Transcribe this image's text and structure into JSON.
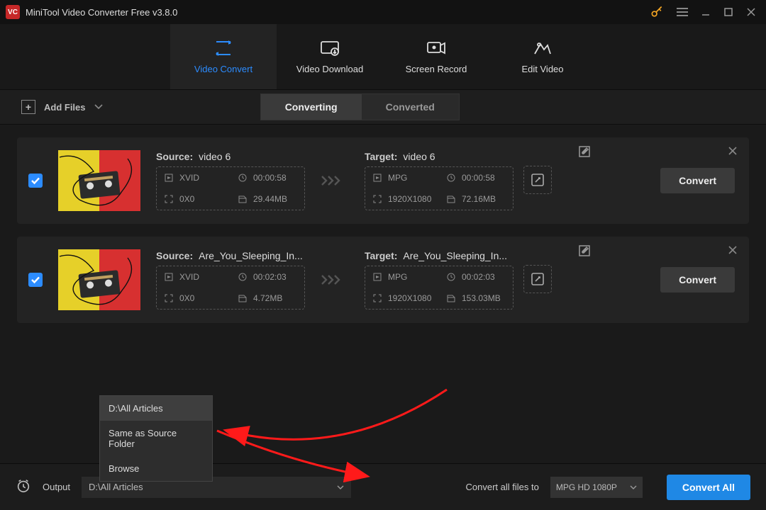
{
  "app": {
    "title": "MiniTool Video Converter Free v3.8.0"
  },
  "nav": {
    "convert": "Video Convert",
    "download": "Video Download",
    "record": "Screen Record",
    "edit": "Edit Video"
  },
  "toolbar": {
    "add_files": "Add Files",
    "converting": "Converting",
    "converted": "Converted"
  },
  "labels": {
    "source": "Source:",
    "target": "Target:",
    "convert": "Convert"
  },
  "files": [
    {
      "source_name": "video 6",
      "target_name": "video 6",
      "src_codec": "XVID",
      "src_duration": "00:00:58",
      "src_res": "0X0",
      "src_size": "29.44MB",
      "tgt_codec": "MPG",
      "tgt_duration": "00:00:58",
      "tgt_res": "1920X1080",
      "tgt_size": "72.16MB"
    },
    {
      "source_name": "Are_You_Sleeping_In...",
      "target_name": "Are_You_Sleeping_In...",
      "src_codec": "XVID",
      "src_duration": "00:02:03",
      "src_res": "0X0",
      "src_size": "4.72MB",
      "tgt_codec": "MPG",
      "tgt_duration": "00:02:03",
      "tgt_res": "1920X1080",
      "tgt_size": "153.03MB"
    }
  ],
  "output_menu": {
    "items": [
      "D:\\All Articles",
      "Same as Source Folder",
      "Browse"
    ],
    "selected_index": 0
  },
  "bottom": {
    "output_label": "Output",
    "output_value": "D:\\All Articles",
    "convert_all_files_to": "Convert all files to",
    "preset": "MPG HD 1080P",
    "convert_all": "Convert All"
  }
}
